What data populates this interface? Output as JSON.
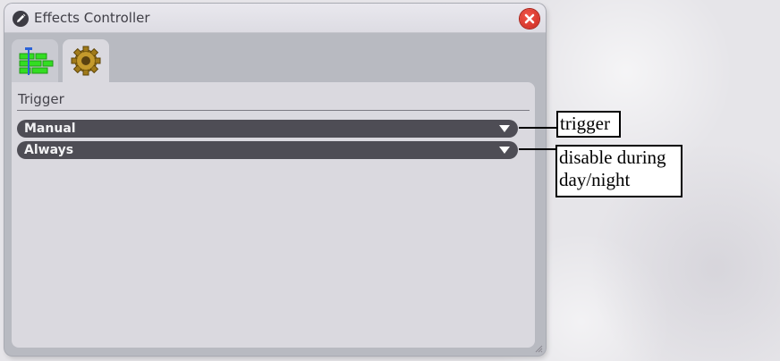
{
  "window": {
    "title": "Effects Controller",
    "title_icon": "pencil-icon",
    "close_icon": "close-icon"
  },
  "tabs": [
    {
      "icon": "timeline-icon",
      "active": false
    },
    {
      "icon": "gear-icon",
      "active": true
    }
  ],
  "panel": {
    "section_title": "Trigger",
    "dropdowns": [
      {
        "value": "Manual"
      },
      {
        "value": "Always"
      }
    ]
  },
  "annotations": [
    {
      "text": "trigger"
    },
    {
      "text": "disable during day/night"
    }
  ],
  "colors": {
    "accent_green": "#33dd22",
    "close_red": "#e03c30",
    "dropdown_bg": "#4e4d55"
  }
}
